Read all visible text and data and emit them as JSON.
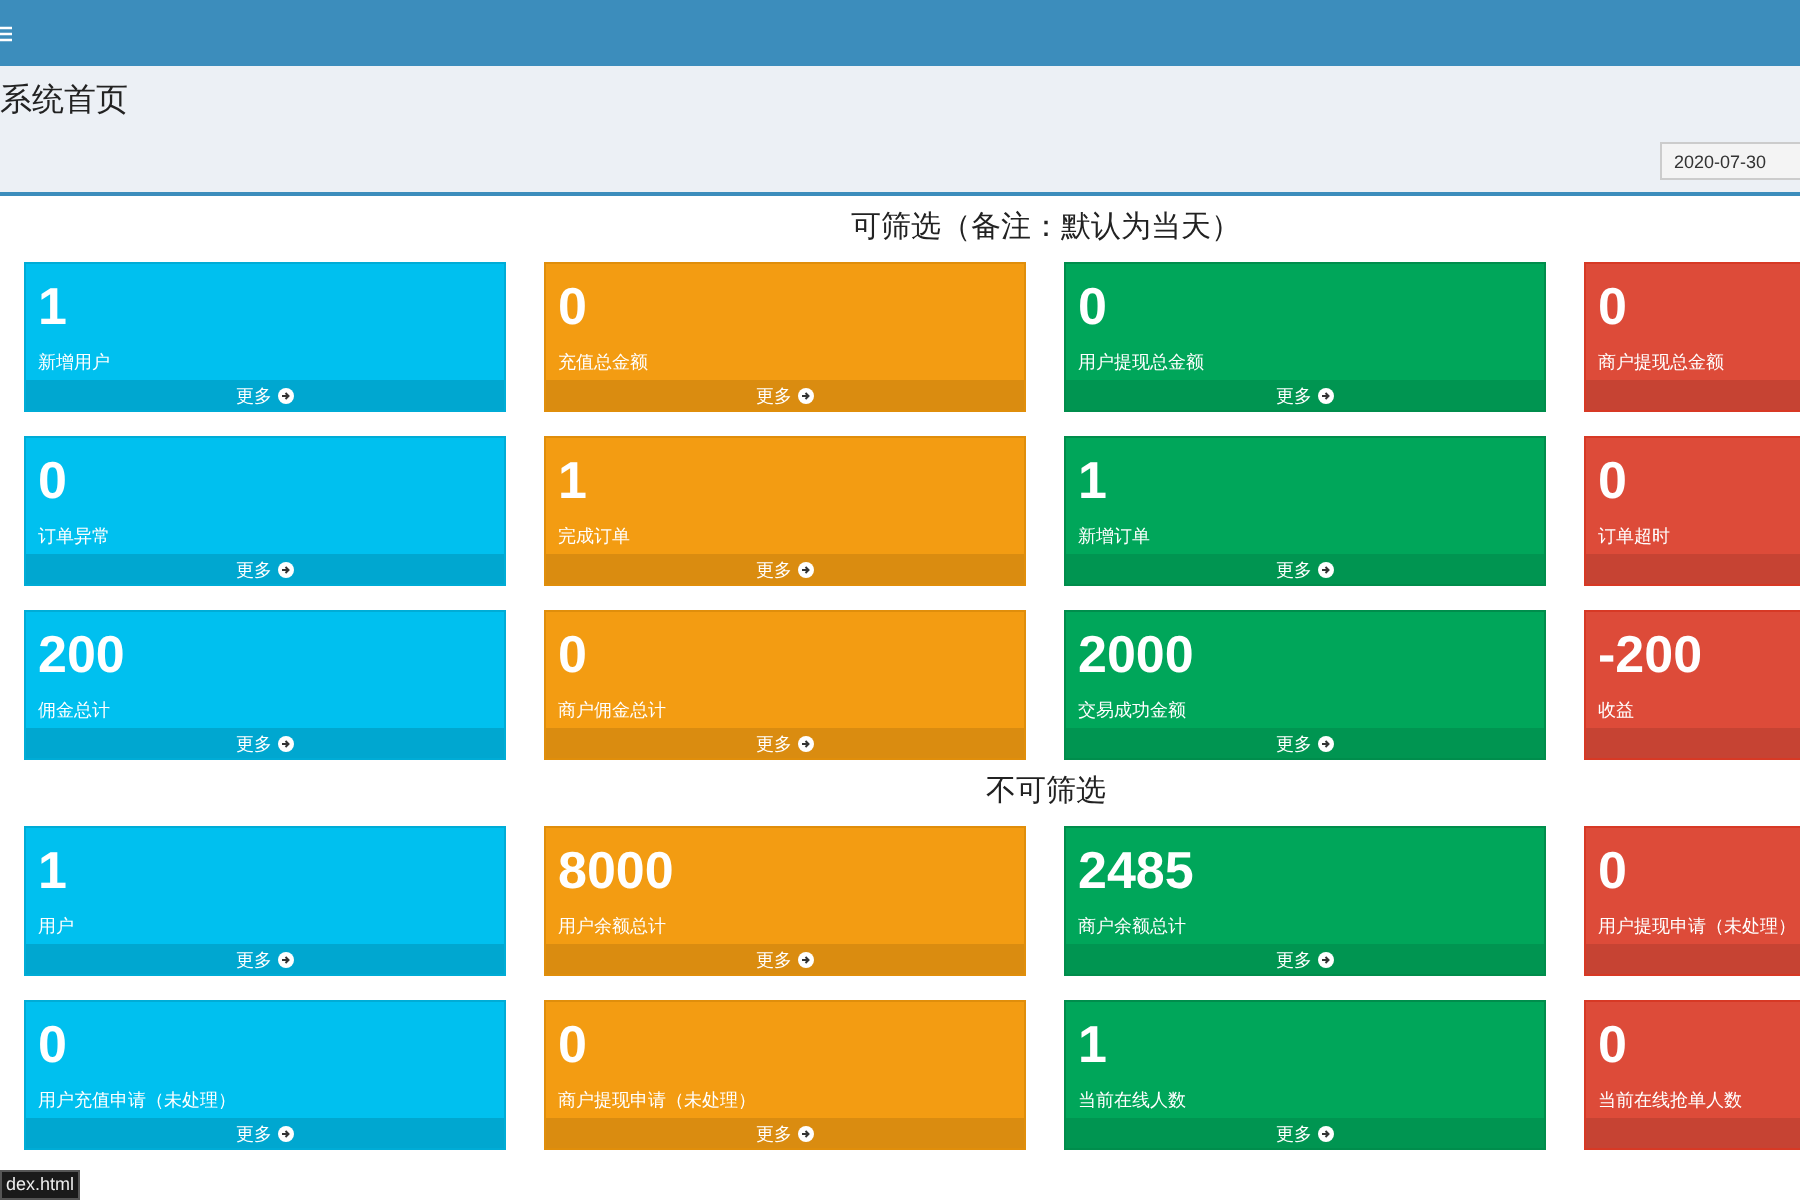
{
  "page_title": "系统首页",
  "date_filter": {
    "value": "2020-07-30"
  },
  "sections": [
    {
      "heading": "可筛选（备注：默认为当天）",
      "cards": [
        {
          "kind": "info",
          "value": "1",
          "label": "新增用户",
          "more": "更多"
        },
        {
          "kind": "warning",
          "value": "0",
          "label": "充值总金额",
          "more": "更多"
        },
        {
          "kind": "success",
          "value": "0",
          "label": "用户提现总金额",
          "more": "更多"
        },
        {
          "kind": "danger",
          "value": "0",
          "label": "商户提现总金额"
        },
        {
          "kind": "info",
          "value": "0",
          "label": "订单异常",
          "more": "更多"
        },
        {
          "kind": "warning",
          "value": "1",
          "label": "完成订单",
          "more": "更多"
        },
        {
          "kind": "success",
          "value": "1",
          "label": "新增订单",
          "more": "更多"
        },
        {
          "kind": "danger",
          "value": "0",
          "label": "订单超时"
        },
        {
          "kind": "info",
          "value": "200",
          "label": "佣金总计",
          "more": "更多"
        },
        {
          "kind": "warning",
          "value": "0",
          "label": "商户佣金总计",
          "more": "更多"
        },
        {
          "kind": "success",
          "value": "2000",
          "label": "交易成功金额",
          "more": "更多"
        },
        {
          "kind": "danger",
          "value": "-200",
          "label": "收益"
        }
      ]
    },
    {
      "heading": "不可筛选",
      "cards": [
        {
          "kind": "info",
          "value": "1",
          "label": "用户",
          "more": "更多"
        },
        {
          "kind": "warning",
          "value": "8000",
          "label": "用户余额总计",
          "more": "更多"
        },
        {
          "kind": "success",
          "value": "2485",
          "label": "商户余额总计",
          "more": "更多"
        },
        {
          "kind": "danger",
          "value": "0",
          "label": "用户提现申请（未处理）"
        },
        {
          "kind": "info",
          "value": "0",
          "label": "用户充值申请（未处理）",
          "more": "更多"
        },
        {
          "kind": "warning",
          "value": "0",
          "label": "商户提现申请（未处理）",
          "more": "更多"
        },
        {
          "kind": "success",
          "value": "1",
          "label": "当前在线人数",
          "more": "更多"
        },
        {
          "kind": "danger",
          "value": "0",
          "label": "当前在线抢单人数"
        }
      ]
    }
  ],
  "status_tooltip": "dex.html"
}
